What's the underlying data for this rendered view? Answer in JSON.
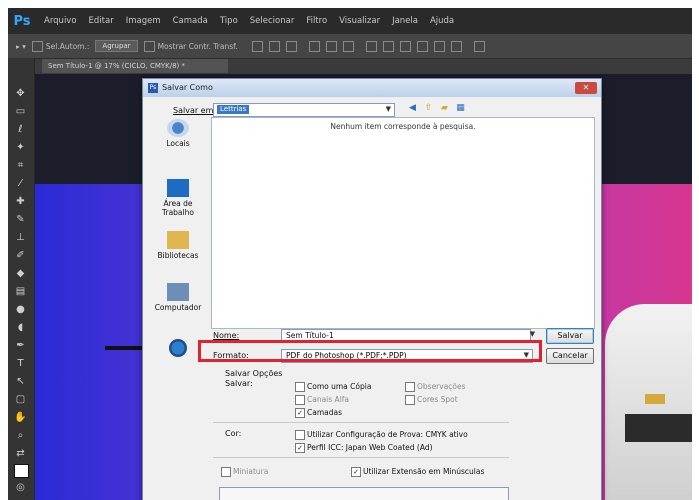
{
  "app": {
    "logo": "Ps",
    "menu": [
      "Arquivo",
      "Editar",
      "Imagem",
      "Camada",
      "Tipo",
      "Selecionar",
      "Filtro",
      "Visualizar",
      "Janela",
      "Ajuda"
    ]
  },
  "options_bar": {
    "auto_select_label": "Sel.Autom.:",
    "group_option": "Agrupar",
    "show_transform": "Mostrar Contr. Transf."
  },
  "doc_tab": "Sem Título-1 @ 17% (CICLO, CMYK/8) *",
  "dialog": {
    "title": "Salvar Como",
    "save_in_label": "Salvar em:",
    "save_in_value": "Lettrias",
    "empty_message": "Nenhum item corresponde à pesquisa.",
    "places": [
      "Locais",
      "Área de Trabalho",
      "Bibliotecas",
      "Computador"
    ],
    "name_label": "Nome:",
    "name_value": "Sem Título-1",
    "format_label": "Formato:",
    "format_value": "PDF do Photoshop (*.PDF;*.PDP)",
    "save_button": "Salvar",
    "cancel_button": "Cancelar",
    "save_options_label": "Salvar Opções",
    "save_label": "Salvar:",
    "options": {
      "as_copy": "Como uma Cópia",
      "alpha": "Canais Alfa",
      "layers": "Camadas",
      "notes": "Observações",
      "spot": "Cores Spot"
    },
    "color_label": "Cor:",
    "proof_setup": "Utilizar Configuração de Prova: CMYK ativo",
    "icc_profile": "Perfil ICC: Japan Web Coated (Ad)",
    "thumbnail": "Miniatura",
    "lowercase_ext": "Utilizar Extensão em Minúsculas"
  },
  "colors": {
    "highlight": "#e2222e",
    "ps_blue": "#31a8ff"
  }
}
